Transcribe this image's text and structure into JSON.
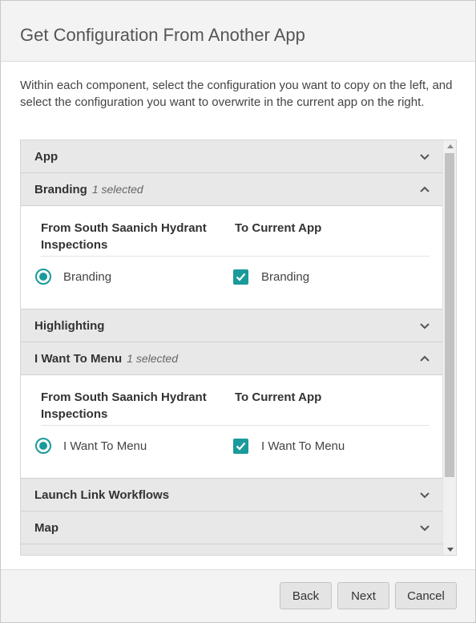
{
  "dialog": {
    "title": "Get Configuration From Another App",
    "instructions": "Within each component, select the configuration you want to copy on the left, and select the configuration you want to overwrite in the current app on the right."
  },
  "panels": [
    {
      "title": "App",
      "badge": "",
      "expanded": false
    },
    {
      "title": "Branding",
      "badge": "1 selected",
      "expanded": true,
      "from_header": "From South Saanich Hydrant Inspections",
      "to_header": "To Current App",
      "from_option": "Branding",
      "from_selected": true,
      "to_option": "Branding",
      "to_checked": true
    },
    {
      "title": "Highlighting",
      "badge": "",
      "expanded": false
    },
    {
      "title": "I Want To Menu",
      "badge": "1 selected",
      "expanded": true,
      "from_header": "From South Saanich Hydrant Inspections",
      "to_header": "To Current App",
      "from_option": "I Want To Menu",
      "from_selected": true,
      "to_option": "I Want To Menu",
      "to_checked": true
    },
    {
      "title": "Launch Link Workflows",
      "badge": "",
      "expanded": false
    },
    {
      "title": "Map",
      "badge": "",
      "expanded": false
    },
    {
      "title": "",
      "badge": "",
      "expanded": false
    }
  ],
  "footer": {
    "back_label": "Back",
    "next_label": "Next",
    "cancel_label": "Cancel"
  },
  "colors": {
    "accent": "#1a9a9a",
    "header_bg": "#f3f3f3",
    "panel_header_bg": "#e8e8e8"
  },
  "icons": {
    "collapsed": "chevron-down-icon",
    "expanded": "chevron-up-icon"
  }
}
